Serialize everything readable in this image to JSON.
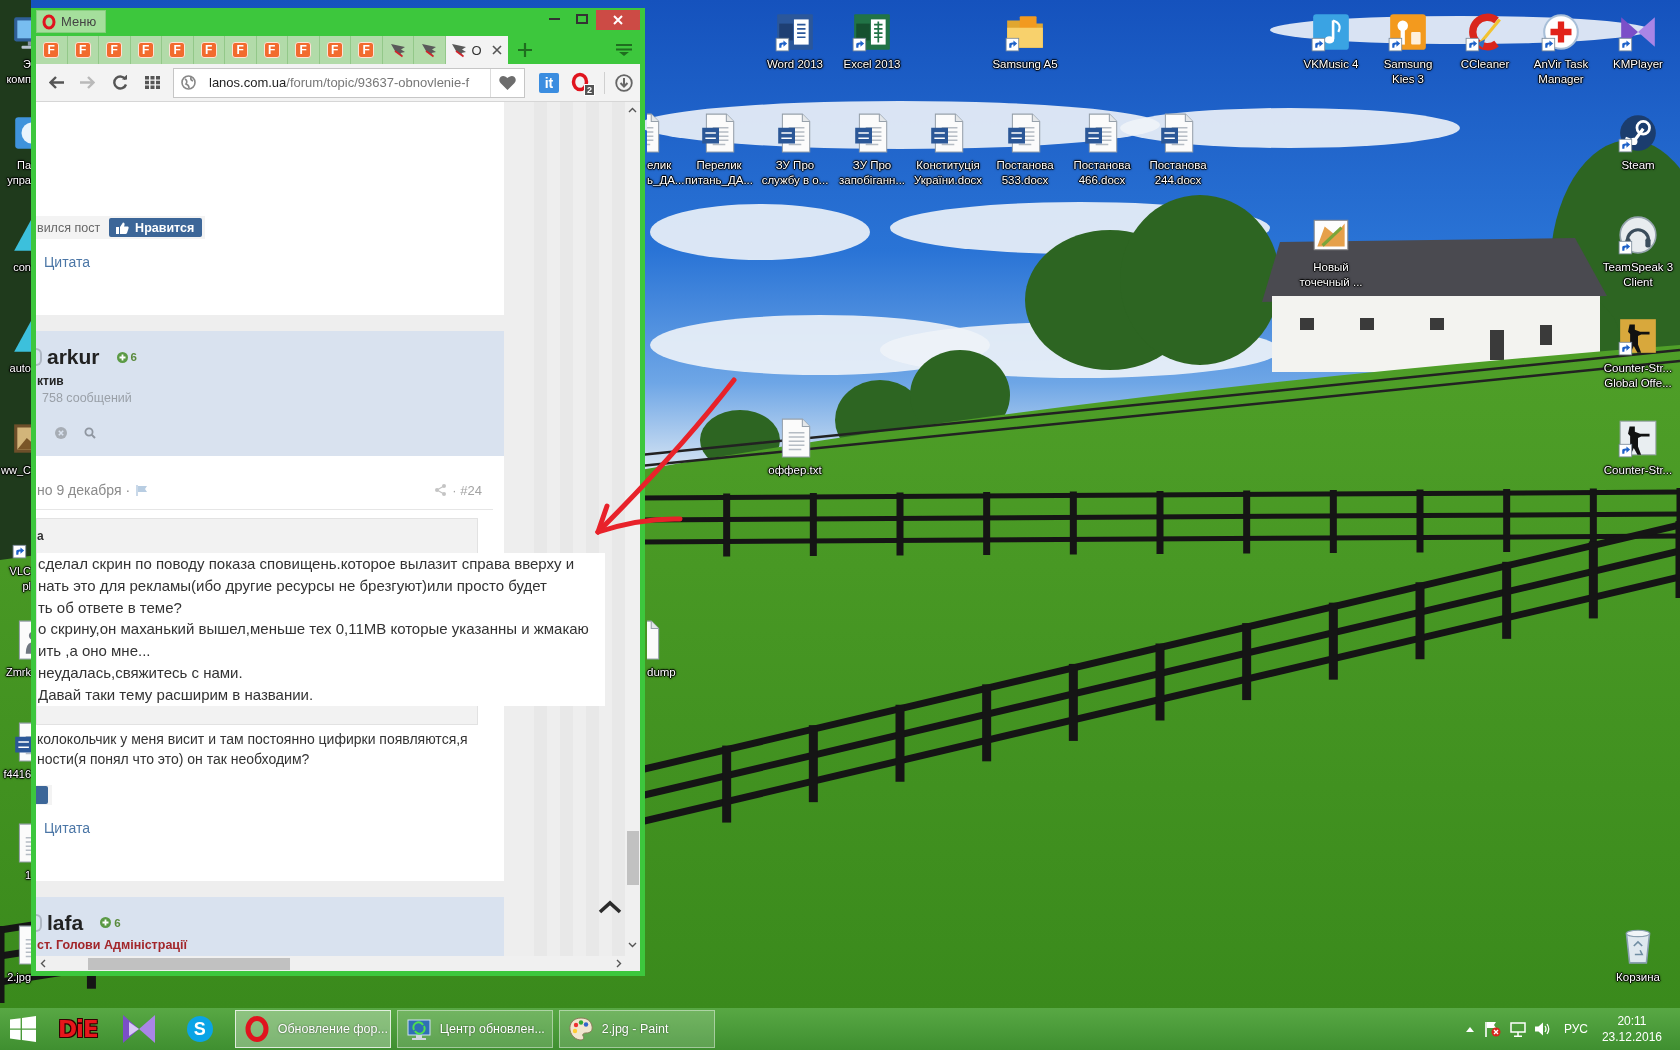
{
  "desktop": {
    "hidden_icons": [
      {
        "kind": "computer",
        "label_lines": [
          "Э",
          "комп"
        ],
        "shortcut": false
      },
      {
        "kind": "control-panel",
        "label_lines": [
          "Па",
          "упра"
        ],
        "shortcut": false
      },
      {
        "kind": "pyramid",
        "label_lines": [
          "con"
        ],
        "shortcut": false
      },
      {
        "kind": "pyramid",
        "label_lines": [
          "auto"
        ],
        "shortcut": false
      },
      {
        "kind": "picture",
        "label_lines": [
          "ww_C"
        ],
        "shortcut": false
      },
      {
        "kind": "shortcut-only",
        "label_lines": [
          "VLC",
          "pl"
        ],
        "shortcut": true
      },
      {
        "kind": "person-file",
        "label_lines": [
          "Zmrk"
        ],
        "shortcut": false
      },
      {
        "kind": "word-doc",
        "label_lines": [
          "f4416"
        ],
        "shortcut": false
      },
      {
        "kind": "document",
        "label_lines": [
          "1"
        ],
        "shortcut": false
      },
      {
        "kind": "document",
        "label_lines": [
          "2.jpg"
        ],
        "shortcut": false
      }
    ],
    "edge_icons": [
      {
        "kind": "word-doc",
        "label_lines": [
          "елик",
          "ь_ДА..."
        ]
      },
      {
        "kind": "blank-file",
        "label_lines": [
          "dump"
        ]
      }
    ],
    "icons": [
      {
        "kind": "word-app",
        "label_lines": [
          "Word 2013"
        ],
        "shortcut": true
      },
      {
        "kind": "excel-app",
        "label_lines": [
          "Excel 2013"
        ],
        "shortcut": true
      },
      {
        "kind": "folder",
        "label_lines": [
          "Samsung A5"
        ],
        "shortcut": true
      },
      {
        "kind": "vkmusic",
        "label_lines": [
          "VKMusic 4"
        ],
        "shortcut": true
      },
      {
        "kind": "kies",
        "label_lines": [
          "Samsung",
          "Kies 3"
        ],
        "shortcut": true
      },
      {
        "kind": "ccleaner",
        "label_lines": [
          "CCleaner"
        ],
        "shortcut": true
      },
      {
        "kind": "anvir",
        "label_lines": [
          "AnVir Task",
          "Manager"
        ],
        "shortcut": true
      },
      {
        "kind": "kmplayer",
        "label_lines": [
          "KMPlayer"
        ],
        "shortcut": true
      },
      {
        "kind": "word-doc",
        "label_lines": [
          "Перелик",
          "питань_ДА..."
        ],
        "shortcut": false
      },
      {
        "kind": "word-doc",
        "label_lines": [
          "ЗУ Про",
          "службу в о..."
        ],
        "shortcut": false
      },
      {
        "kind": "word-doc",
        "label_lines": [
          "ЗУ Про",
          "запобіганн..."
        ],
        "shortcut": false
      },
      {
        "kind": "word-doc",
        "label_lines": [
          "Конституція",
          "України.docx"
        ],
        "shortcut": false
      },
      {
        "kind": "word-doc",
        "label_lines": [
          "Постанова",
          "533.docx"
        ],
        "shortcut": false
      },
      {
        "kind": "word-doc",
        "label_lines": [
          "Постанова",
          "466.docx"
        ],
        "shortcut": false
      },
      {
        "kind": "word-doc",
        "label_lines": [
          "Постанова",
          "244.docx"
        ],
        "shortcut": false
      },
      {
        "kind": "steam",
        "label_lines": [
          "Steam"
        ],
        "shortcut": true
      },
      {
        "kind": "bitmap",
        "label_lines": [
          "Новый",
          "точечный ..."
        ],
        "shortcut": false
      },
      {
        "kind": "teamspeak",
        "label_lines": [
          "TeamSpeak 3",
          "Client"
        ],
        "shortcut": true
      },
      {
        "kind": "csgo",
        "label_lines": [
          "Counter-Str...",
          "Global Offe..."
        ],
        "shortcut": true
      },
      {
        "kind": "text-file",
        "label_lines": [
          "оффер.txt"
        ],
        "shortcut": false
      },
      {
        "kind": "counter-strike",
        "label_lines": [
          "Counter-Str..."
        ],
        "shortcut": true
      },
      {
        "kind": "recycle-bin",
        "label_lines": [
          "Корзина"
        ],
        "shortcut": false
      }
    ]
  },
  "browser": {
    "menu_label": "Меню",
    "tabs": [
      {
        "kind": "letter",
        "favicon": "F",
        "selected": false
      },
      {
        "kind": "letter",
        "favicon": "F",
        "selected": false
      },
      {
        "kind": "letter",
        "favicon": "F",
        "selected": false
      },
      {
        "kind": "letter",
        "favicon": "F",
        "selected": false
      },
      {
        "kind": "letter",
        "favicon": "F",
        "selected": false
      },
      {
        "kind": "letter",
        "favicon": "F",
        "selected": false
      },
      {
        "kind": "letter",
        "favicon": "F",
        "selected": false
      },
      {
        "kind": "letter",
        "favicon": "F",
        "selected": false
      },
      {
        "kind": "letter",
        "favicon": "F",
        "selected": false
      },
      {
        "kind": "letter",
        "favicon": "F",
        "selected": false
      },
      {
        "kind": "letter",
        "favicon": "F",
        "selected": false
      },
      {
        "kind": "feather",
        "selected": false
      },
      {
        "kind": "feather",
        "selected": false
      },
      {
        "kind": "feather",
        "title": "О",
        "selected": true
      }
    ],
    "navigation": {
      "back_disabled": false,
      "forward_disabled": true
    },
    "address": {
      "host": "lanos.com.ua",
      "path": "/forum/topic/93637-obnovlenie-f"
    },
    "extensions": [
      {
        "kind": "label-button",
        "label": "it"
      },
      {
        "kind": "ring-badge",
        "badge": "2"
      }
    ],
    "page": {
      "first_post": {
        "like_prompt": "вился пост",
        "like_button": "Нравится",
        "quote_link": "Цитата"
      },
      "author": {
        "name": "arkur",
        "reputation": "6",
        "rank": "ктив",
        "post_count": "758 сообщений"
      },
      "post": {
        "date": "но 9 декабря ·",
        "post_number": "· #24",
        "quote_author": "а",
        "quote_lines": [
          "сделал скрин по поводу показа сповищень.которое вылазит справа вверху и",
          "нать это для рекламы(ибо другие ресурсы не брезгуют)или просто будет",
          "ть об ответе в теме?",
          "о скрину,он маханький вышел,меньше тех 0,11МВ которые указанны и жмакаю",
          "ить ,а оно мне...",
          "неудалась,свяжитесь с нами.",
          "Давай таки тему расширим в названии."
        ],
        "body_lines": [
          "колокольчик у меня висит и там постоянно цифирки появляются,я",
          "ности(я понял что это) он так необходим?"
        ],
        "quote_link": "Цитата"
      },
      "next_author": {
        "name": "lafa",
        "reputation": "6",
        "rank": "ст. Голови Адміністрації"
      }
    }
  },
  "taskbar": {
    "pinned": [
      {
        "kind": "die",
        "label": "DiE"
      },
      {
        "kind": "play"
      },
      {
        "kind": "round",
        "label": "S"
      }
    ],
    "windows": [
      {
        "kind": "opera",
        "title": "Обновление фор...",
        "selected": true
      },
      {
        "kind": "update",
        "title": "Центр обновлен...",
        "selected": false
      },
      {
        "kind": "paint",
        "title": "2.jpg - Paint",
        "selected": false
      }
    ],
    "language": "РУС",
    "time": "20:11",
    "date": "23.12.2016"
  }
}
